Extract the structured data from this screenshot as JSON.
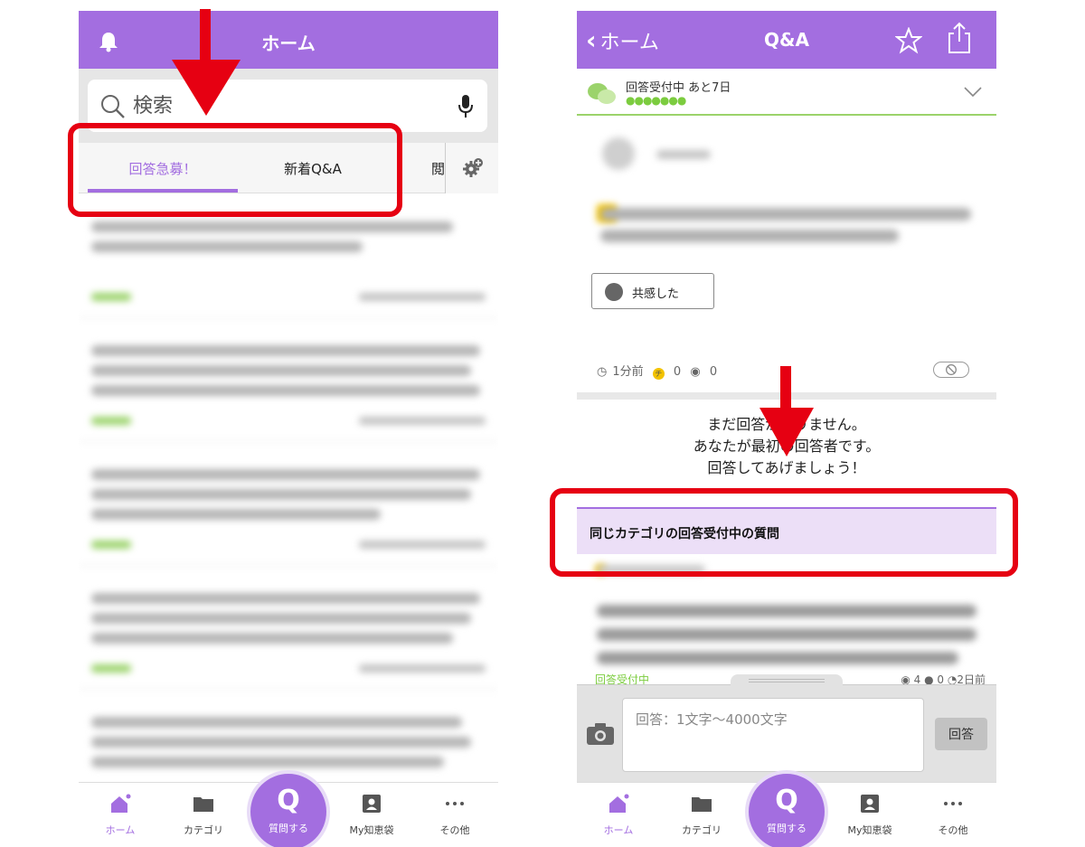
{
  "colors": {
    "brand": "#a36ee0",
    "annotation": "#e60012",
    "status_green": "#7ccc3f"
  },
  "left_screen": {
    "header": {
      "title": "ホーム",
      "bell_icon": "bell-icon"
    },
    "search": {
      "placeholder": "検索",
      "icon": "search-icon",
      "mic_icon": "mic-icon"
    },
    "tabs": [
      {
        "label": "回答急募！",
        "active": true
      },
      {
        "label": "新着Q&A",
        "active": false
      },
      {
        "label": "閲",
        "active": false
      }
    ],
    "tab_settings_icon": "gear-plus-icon"
  },
  "right_screen": {
    "header": {
      "back_label": "ホーム",
      "title": "Q&A",
      "star_icon": "star-icon",
      "share_icon": "share-icon"
    },
    "status": {
      "label": "回答受付中 あと7日",
      "dots": "●●●●●●●"
    },
    "question": {
      "empathy_label": "共感した",
      "time": "1分前",
      "chips": "0",
      "views": "0"
    },
    "no_answer": {
      "line1": "まだ回答がありません。",
      "line2": "あなたが最初の回答者です。",
      "line3": "回答してあげましょう！"
    },
    "related": {
      "header": "同じカテゴリの回答受付中の質問",
      "item_status": "回答受付中",
      "item_views": "4",
      "item_answers": "0",
      "item_time": "2日前"
    },
    "answer_box": {
      "placeholder": "回答：1文字〜4000文字",
      "submit_label": "回答"
    }
  },
  "bottom_nav": [
    {
      "label": "ホーム",
      "icon": "home-icon",
      "active": true
    },
    {
      "label": "カテゴリ",
      "icon": "folder-icon",
      "active": false
    },
    {
      "label": "質問する",
      "icon": "q-icon",
      "active": false
    },
    {
      "label": "My知恵袋",
      "icon": "profile-card-icon",
      "active": false
    },
    {
      "label": "その他",
      "icon": "more-icon",
      "active": false
    }
  ]
}
